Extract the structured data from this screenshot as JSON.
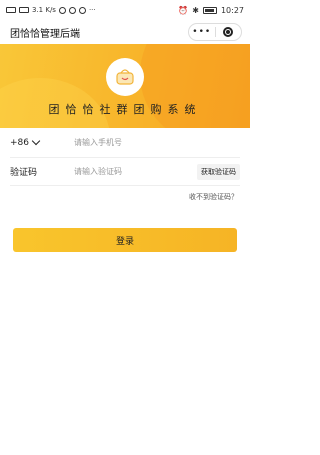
{
  "status_bar": {
    "network_text": "3.1 K/s",
    "time": "10:27"
  },
  "nav": {
    "title": "团恰恰管理后端",
    "menu_glyph": "•••"
  },
  "banner": {
    "title": "团恰恰社群团购系统"
  },
  "form": {
    "country_code": "+86",
    "phone_placeholder": "请输入手机号",
    "code_label": "验证码",
    "code_placeholder": "请输入验证码",
    "get_code_label": "获取验证码",
    "no_code_link": "收不到验证码？"
  },
  "actions": {
    "login_label": "登录"
  },
  "colors": {
    "accent": "#f8b42a",
    "button": "#f6b425"
  }
}
